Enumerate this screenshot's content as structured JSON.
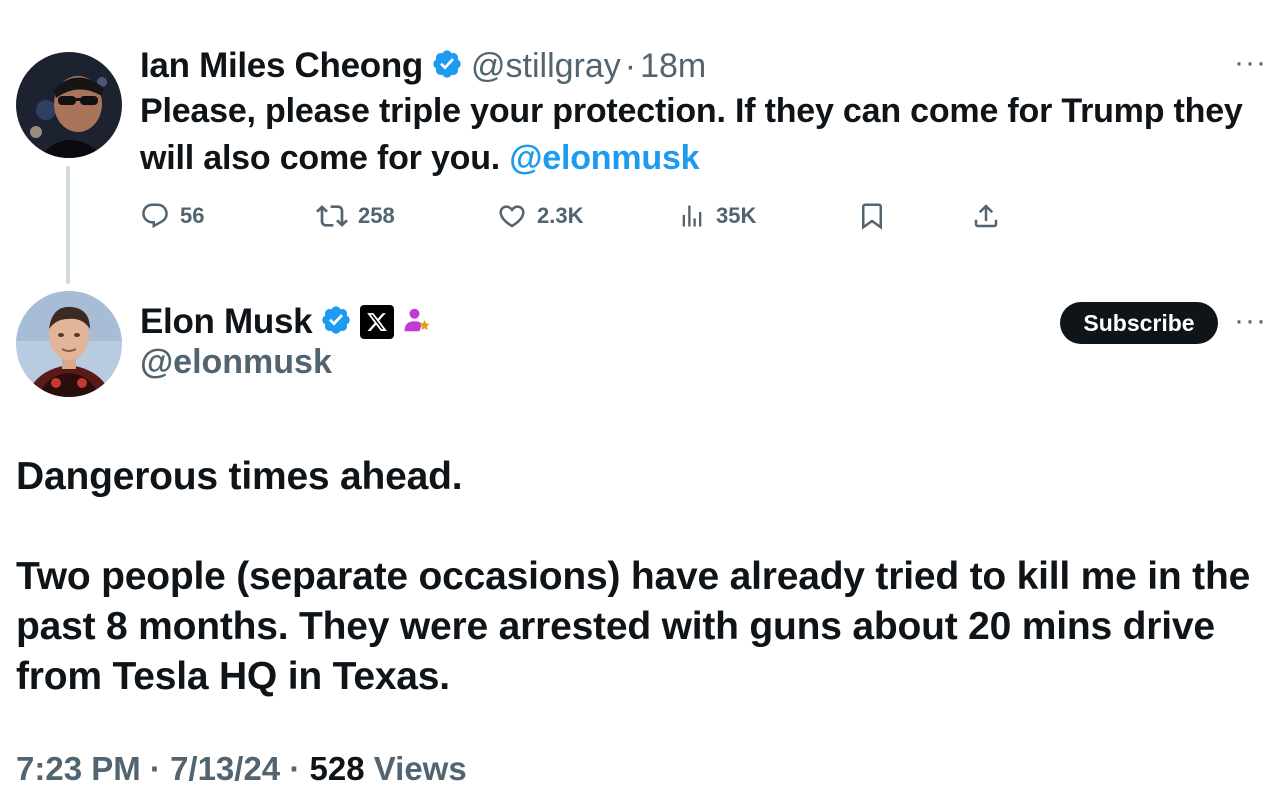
{
  "reply": {
    "author": {
      "display_name": "Ian Miles Cheong",
      "handle": "@stillgray",
      "verified": true
    },
    "separator": "·",
    "time_ago": "18m",
    "text_before": "Please, please triple your protection. If they can come for Trump they will also come for you.",
    "mention": "@elonmusk",
    "actions": {
      "replies": "56",
      "reposts": "258",
      "likes": "2.3K",
      "views": "35K"
    }
  },
  "post": {
    "author": {
      "display_name": "Elon Musk",
      "handle": "@elonmusk",
      "verified": true
    },
    "subscribe_label": "Subscribe",
    "paragraph_1": "Dangerous times ahead.",
    "paragraph_2": "Two people (separate occasions) have already tried to kill me in the past 8 months. They were arrested with guns about 20 mins drive from Tesla HQ in Texas.",
    "meta": {
      "time": "7:23 PM",
      "date": "7/13/24",
      "separator": "·",
      "views_count": "528",
      "views_label": "Views"
    }
  },
  "more_label": "···",
  "colors": {
    "text": "#0f1419",
    "secondary": "#536471",
    "accent": "#1d9bf0",
    "verified": "#1d9bf0",
    "affiliate": "#c23ad6"
  },
  "icons": [
    "verified-badge-icon",
    "x-logo-icon",
    "affiliate-badge-icon",
    "reply-icon",
    "repost-icon",
    "like-icon",
    "views-icon",
    "bookmark-icon",
    "share-icon",
    "more-icon"
  ]
}
